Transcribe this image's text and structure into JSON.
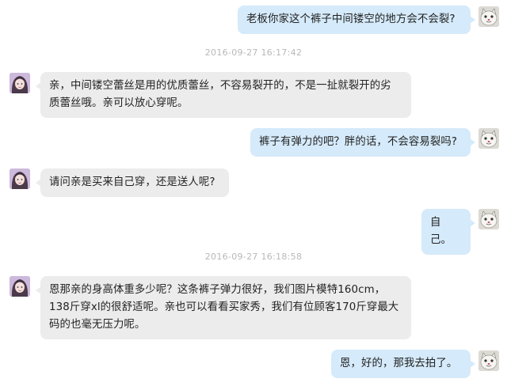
{
  "messages": [
    {
      "sender": "buyer",
      "text": "老板你家这个裤子中间镂空的地方会不会裂?"
    },
    {
      "sender": "seller",
      "text": "亲，中间镂空蕾丝是用的优质蕾丝，不容易裂开的，不是一扯就裂开的劣质蕾丝哦。亲可以放心穿呢。"
    },
    {
      "sender": "buyer",
      "text": "裤子有弹力的吧？胖的话，不会容易裂吗?"
    },
    {
      "sender": "seller",
      "text": "请问亲是买来自己穿，还是送人呢?"
    },
    {
      "sender": "buyer",
      "text": "自己。"
    },
    {
      "sender": "seller",
      "text": "恩那亲的身高体重多少呢？这条裤子弹力很好，我们图片模特160cm，138斤穿xl的很舒适呢。亲也可以看看买家秀，我们有位顾客170斤穿最大码的也毫无压力呢。"
    },
    {
      "sender": "buyer",
      "text": "恩，好的，那我去拍了。"
    }
  ],
  "timestamps": [
    "2016-09-27 16:17:42",
    "2016-09-27 16:18:58"
  ],
  "icons": {
    "buyer_avatar": "cartoon-cat-avatar-icon",
    "seller_avatar": "girl-portrait-avatar-icon"
  },
  "colors": {
    "buyer_bubble": "#d5eafa",
    "seller_bubble": "#ececec",
    "timestamp": "#b8b8b8"
  }
}
